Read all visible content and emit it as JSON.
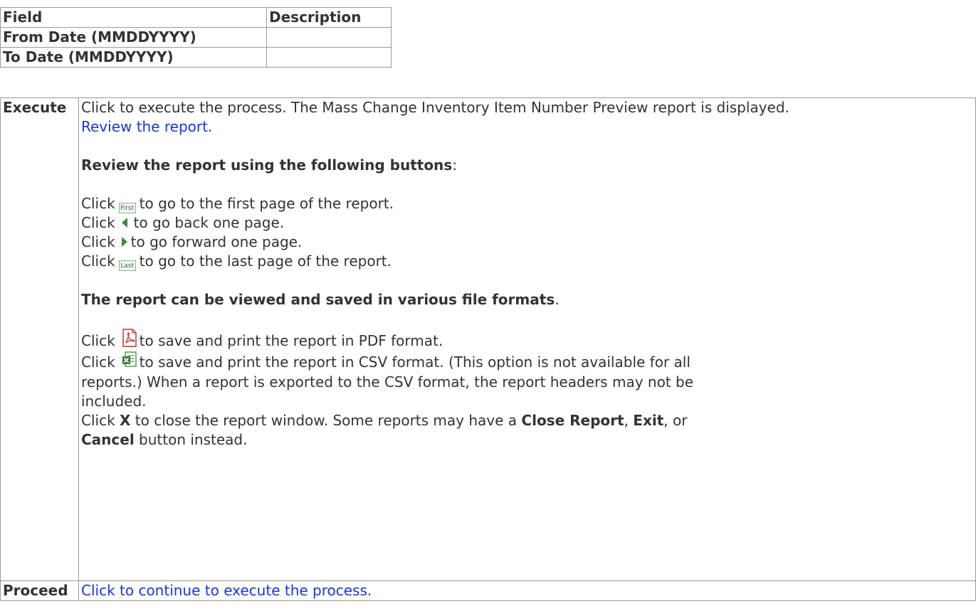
{
  "header": {
    "field": "Field",
    "description": "Description"
  },
  "fields": [
    {
      "label": "From Date (MMDDYYYY)",
      "description": ""
    },
    {
      "label": "To Date (MMDDYYYY)",
      "description": ""
    }
  ],
  "execute": {
    "label": "Execute",
    "intro": "Click to execute the process. The Mass Change Inventory Item Number Preview report is displayed.",
    "review_link": "Review the report.",
    "review_heading": "Review the report using the following buttons",
    "review_heading_suffix": ":",
    "click": "Click",
    "first_btn": "First",
    "last_btn": "Last",
    "first_text": "to go to the first page of the report.",
    "back_text": "to go back one page.",
    "forward_text": "to go forward one page.",
    "last_text": "to go to the last page of the report.",
    "formats_heading": "The report can be viewed and saved in various file formats",
    "formats_heading_suffix": ".",
    "pdf_text": "to save and print the report in PDF format.",
    "csv_text_1": "to save and print the report in CSV format. (This option is not available for all",
    "csv_text_2": "reports.) When a report is exported to the CSV format, the report headers may not be",
    "csv_text_3": "included.",
    "close_pre": "Click",
    "close_x": "X",
    "close_mid": "to close the report window. Some reports may have a",
    "close_report": "Close Report",
    "comma1": ",",
    "exit": "Exit",
    "comma_or": ", or",
    "cancel": "Cancel",
    "close_end": "button instead."
  },
  "proceed": {
    "label": "Proceed",
    "link": "Click to continue to execute the process."
  },
  "icons": {
    "first": "first-page-button-icon",
    "back": "back-arrow-icon",
    "forward": "forward-arrow-icon",
    "last": "last-page-button-icon",
    "pdf": "pdf-icon",
    "csv": "csv-excel-icon"
  },
  "colors": {
    "link": "#1a33e6",
    "border": "#999999",
    "arrow": "#3d8a3d"
  }
}
